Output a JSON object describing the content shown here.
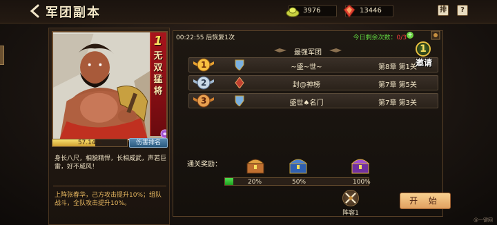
{
  "header": {
    "title": "军团副本",
    "resources": [
      {
        "name": "gold",
        "value": "3976",
        "icon": "gold-ingot-icon"
      },
      {
        "name": "gems",
        "value": "13446",
        "icon": "gem-icon"
      }
    ],
    "rank_button": "排",
    "help_button": "?"
  },
  "hero": {
    "rank": "1",
    "name": "无双猛将",
    "progress_text": "57.14%",
    "progress": 0.5714,
    "rank_button": "伤害排名",
    "description": "身长八尺，相貌精悍，长相威武，声若巨雷，好不威风！",
    "bonus": "上阵张春华，己方攻击提升10%；组队战斗，全队攻击提升10%。"
  },
  "status": {
    "timer": "00:22:55 后恢复1次",
    "daily_label": "今日剩余次数：",
    "daily_count": "0/3"
  },
  "ranking": {
    "header": "最强军团",
    "rows": [
      {
        "rank": "1",
        "guild": "~盛~世~",
        "progress": "第8章 第1关",
        "medal_color": "#e8a030"
      },
      {
        "rank": "2",
        "guild": "封@神榜",
        "progress": "第7章 第5关",
        "medal_color": "#a0b8d0"
      },
      {
        "rank": "3",
        "guild": "盛世♠名门",
        "progress": "第7章 第3关",
        "medal_color": "#d08030"
      }
    ]
  },
  "invite": {
    "count": "1",
    "label": "邀请"
  },
  "rewards": {
    "label": "通关奖励：",
    "progress": 0.06,
    "milestones": [
      "20%",
      "50%",
      "100%"
    ]
  },
  "lineup": {
    "label": "阵容1"
  },
  "start_button": "开 始",
  "watermark": "@一键网"
}
